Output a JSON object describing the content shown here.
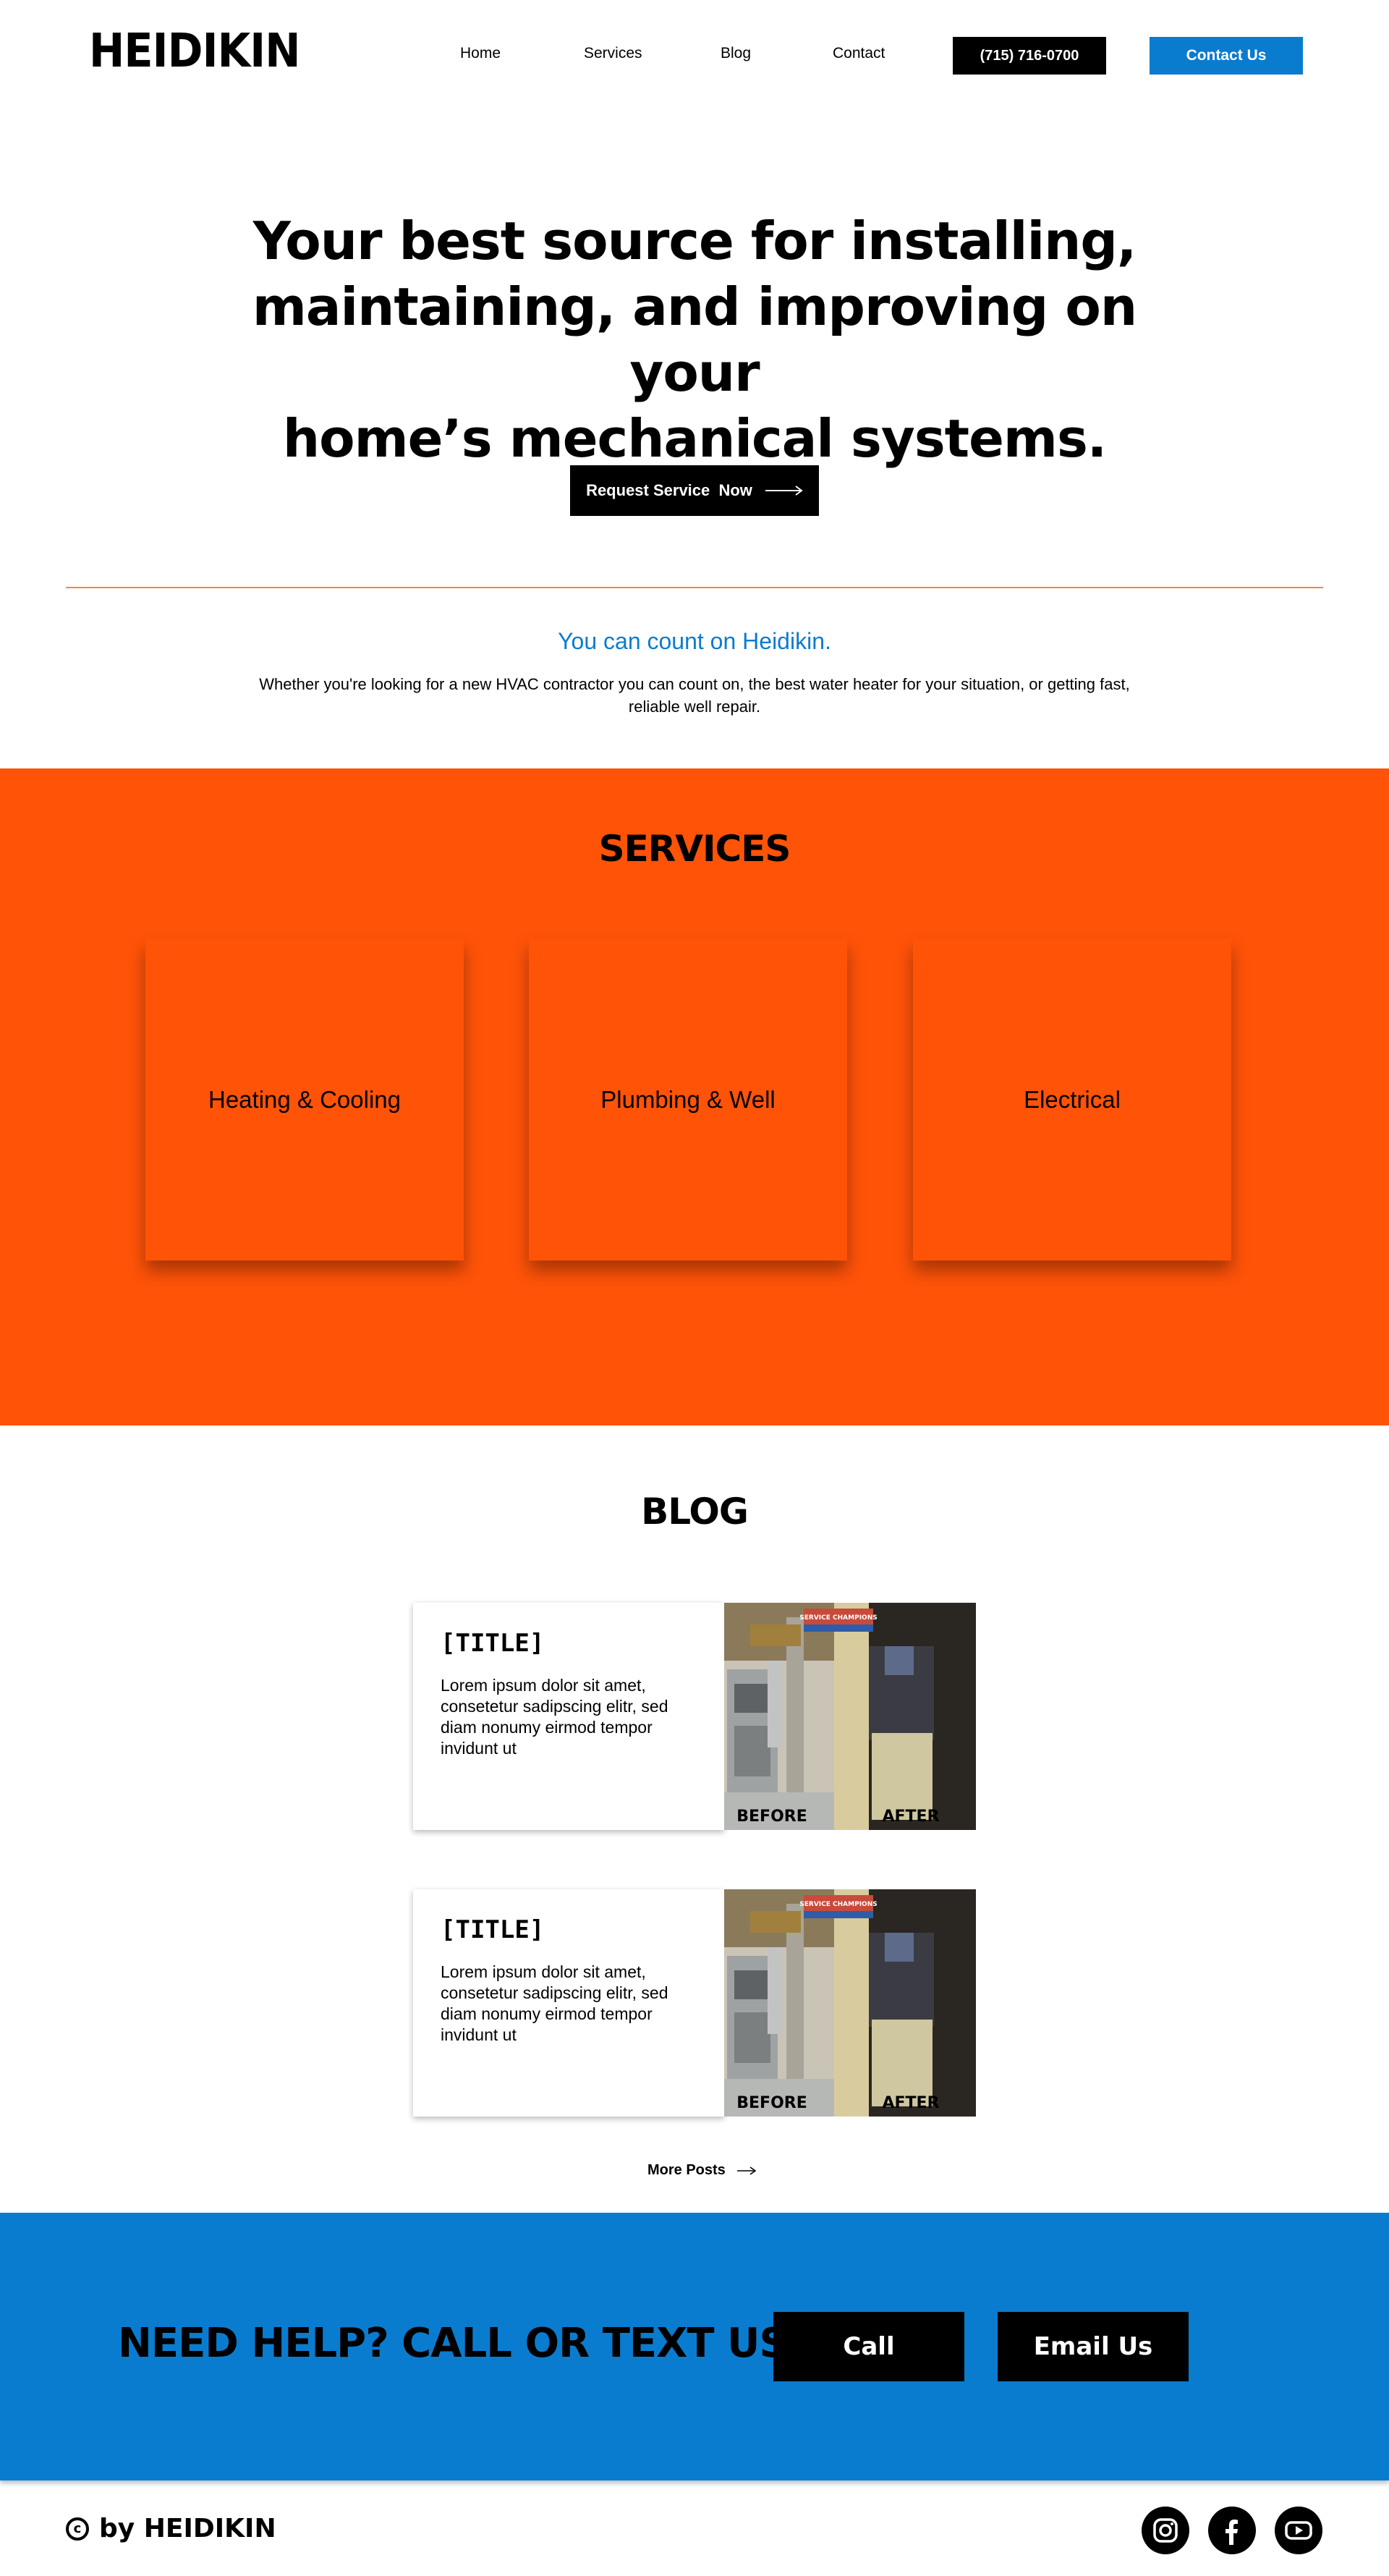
{
  "header": {
    "logo": "HEIDIKIN",
    "nav": [
      "Home",
      "Services",
      "Blog",
      "Contact"
    ],
    "phone": "(715) 716-0700",
    "contact_button": "Contact Us"
  },
  "hero": {
    "title_lines": [
      "Your best source for installing,",
      "maintaining, and improving on your",
      "home’s mechanical systems."
    ],
    "cta": "Request Service  Now"
  },
  "intro": {
    "heading": "You can count on Heidikin.",
    "text": "Whether you're looking for a new HVAC contractor you can count on, the best water heater for your situation, or getting fast, reliable well repair."
  },
  "services": {
    "title": "SERVICES",
    "cards": [
      "Heating & Cooling",
      "Plumbing & Well",
      "Electrical"
    ]
  },
  "blog": {
    "title": "BLOG",
    "posts": [
      {
        "title": "[TITLE]",
        "excerpt": "Lorem ipsum dolor sit amet, consetetur sadipscing elitr, sed diam nonumy eirmod tempor invidunt ut",
        "image_before": "BEFORE",
        "image_after": "AFTER",
        "image_sign": "SERVICE CHAMPIONS"
      },
      {
        "title": "[TITLE]",
        "excerpt": "Lorem ipsum dolor sit amet, consetetur sadipscing elitr, sed diam nonumy eirmod tempor invidunt ut",
        "image_before": "BEFORE",
        "image_after": "AFTER",
        "image_sign": "SERVICE CHAMPIONS"
      }
    ],
    "more": "More Posts"
  },
  "cta": {
    "title": "NEED HELP? CALL OR TEXT US!",
    "call": "Call",
    "email": "Email Us"
  },
  "footer": {
    "brand": "by HEIDIKIN",
    "copyright_symbol": "c",
    "social": [
      "instagram-icon",
      "facebook-icon",
      "youtube-icon"
    ]
  },
  "colors": {
    "orange": "#ff5308",
    "blue": "#0a7ccf",
    "divider": "#f0874a",
    "black": "#000000"
  }
}
